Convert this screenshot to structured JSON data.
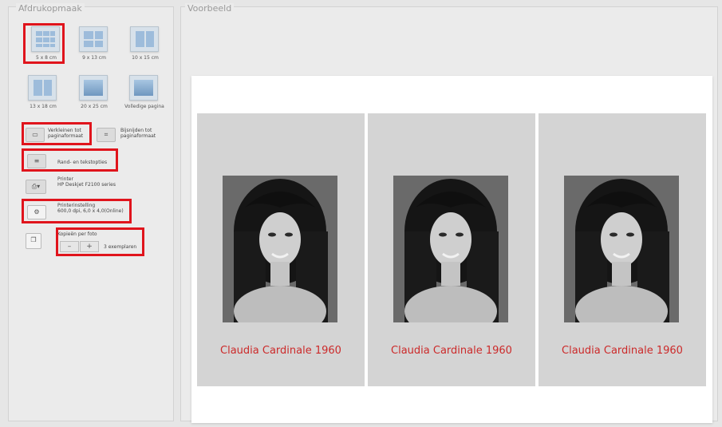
{
  "left_panel": {
    "title": "Afdrukopmaak"
  },
  "preview": {
    "title": "Voorbeeld"
  },
  "layouts": [
    {
      "label": "5 x 8 cm"
    },
    {
      "label": "9 x 13 cm"
    },
    {
      "label": "10 x 15 cm"
    },
    {
      "label": "13 x 18 cm"
    },
    {
      "label": "20 x 25 cm"
    },
    {
      "label": "Volledige pagina"
    }
  ],
  "options": {
    "scale_line1": "Verkleinen tot",
    "scale_line2": "paginaformaat",
    "crop_line1": "Bijsnijden tot",
    "crop_line2": "paginaformaat",
    "border_text": "Rand- en tekstopties",
    "printer_label": "Printer",
    "printer_name": "HP Deskjet F2100 series",
    "printer_setting_label": "Printerinstelling",
    "printer_setting_value": "600,0 dpi, 6,0 x 4,0(Online)",
    "copies_label": "Kopieën per foto",
    "copies_minus": "–",
    "copies_plus": "+",
    "copies_value": "3 exemplaren"
  },
  "prints": [
    {
      "caption": "Claudia Cardinale 1960"
    },
    {
      "caption": "Claudia Cardinale 1960"
    },
    {
      "caption": "Claudia Cardinale 1960"
    }
  ],
  "colors": {
    "highlight": "#e0141c",
    "caption": "#cc2a2a",
    "thumbnail_blue": "#9dbcdb"
  },
  "icons": {
    "scale": "fit-page-icon",
    "crop": "crop-icon",
    "border": "text-border-icon",
    "printer": "printer-icon",
    "printer_setting": "printer-settings-icon",
    "copies": "copies-icon"
  }
}
